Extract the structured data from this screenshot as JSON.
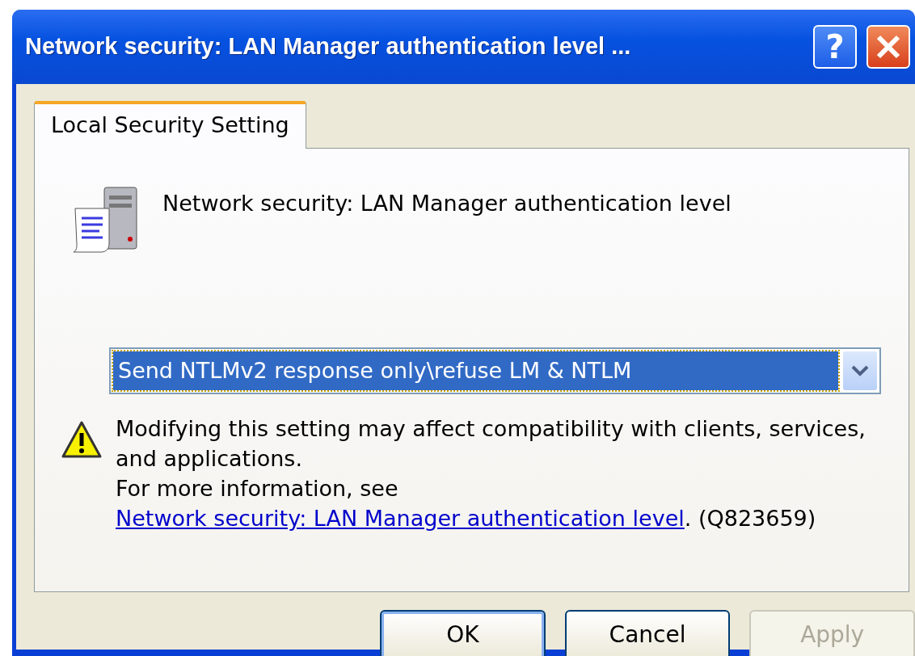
{
  "window": {
    "title": "Network security: LAN Manager authentication level ...",
    "help_label": "?"
  },
  "tabs": [
    {
      "label": "Local Security Setting",
      "selected": true
    }
  ],
  "policy": {
    "name": "Network security: LAN Manager authentication level"
  },
  "dropdown": {
    "value": "Send NTLMv2 response only\\refuse LM & NTLM",
    "focused": true
  },
  "warning": {
    "text": "Modifying this setting may affect compatibility with clients, services, and applications.",
    "more_prefix": "For more information, see ",
    "link": "Network security: LAN Manager authentication level",
    "suffix": ". (Q823659)"
  },
  "buttons": [
    {
      "label": "OK",
      "disabled": false,
      "default": true
    },
    {
      "label": "Cancel",
      "disabled": false,
      "default": false
    },
    {
      "label": "Apply",
      "disabled": true,
      "default": false
    }
  ]
}
